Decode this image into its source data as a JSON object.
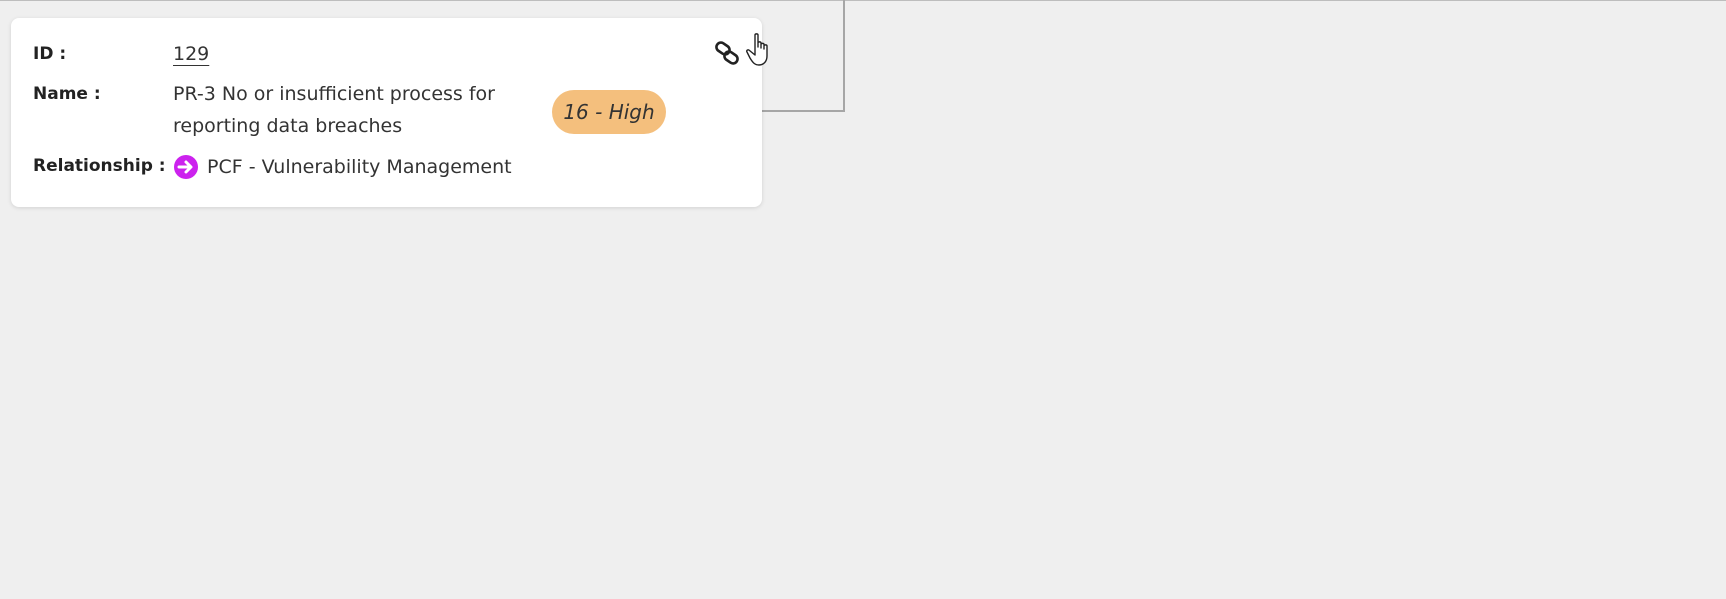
{
  "card": {
    "id_label": "ID :",
    "id_value": "129",
    "name_label": "Name :",
    "name_value": "PR-3 No or insufficient process for reporting data breaches",
    "relationship_label": "Relationship :",
    "relationship_value": "PCF - Vulnerability Management",
    "relationship_icon": "arrow-right-circle-icon",
    "badge": {
      "text": "16 - High",
      "color": "#f4bf7d"
    },
    "link_icon": "chain-link-icon"
  },
  "colors": {
    "background": "#efefef",
    "card": "#ffffff",
    "relationship_icon": "#cc22ee",
    "connector": "#a6a6a6"
  }
}
